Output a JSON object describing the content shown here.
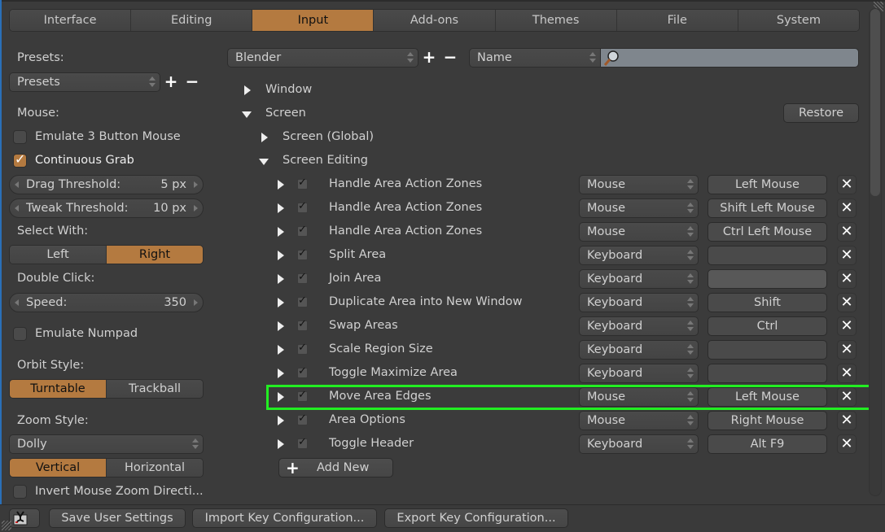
{
  "tabs": [
    {
      "label": "Interface",
      "active": false
    },
    {
      "label": "Editing",
      "active": false
    },
    {
      "label": "Input",
      "active": true
    },
    {
      "label": "Add-ons",
      "active": false
    },
    {
      "label": "Themes",
      "active": false
    },
    {
      "label": "File",
      "active": false
    },
    {
      "label": "System",
      "active": false
    }
  ],
  "left": {
    "presets_label": "Presets:",
    "presets_value": "Presets",
    "mouse_label": "Mouse:",
    "emulate_3button": {
      "label": "Emulate 3 Button Mouse",
      "checked": false
    },
    "continuous_grab": {
      "label": "Continuous Grab",
      "checked": true
    },
    "drag_threshold": {
      "label": "Drag Threshold:",
      "value": "5 px"
    },
    "tweak_threshold": {
      "label": "Tweak Threshold:",
      "value": "10 px"
    },
    "select_with_label": "Select With:",
    "select_with": {
      "options": [
        "Left",
        "Right"
      ],
      "selected": "Right"
    },
    "double_click_label": "Double Click:",
    "speed": {
      "label": "Speed:",
      "value": "350"
    },
    "emulate_numpad": {
      "label": "Emulate Numpad",
      "checked": false
    },
    "orbit_style_label": "Orbit Style:",
    "orbit_style": {
      "options": [
        "Turntable",
        "Trackball"
      ],
      "selected": "Turntable"
    },
    "zoom_style_label": "Zoom Style:",
    "zoom_style_value": "Dolly",
    "zoom_axis": {
      "options": [
        "Vertical",
        "Horizontal"
      ],
      "selected": "Vertical"
    },
    "invert_zoom": {
      "label": "Invert Mouse Zoom Directi...",
      "checked": false
    }
  },
  "keymap": {
    "preset_value": "Blender",
    "filter_type": "Name",
    "search_value": "",
    "restore_label": "Restore",
    "tree": {
      "window": "Window",
      "screen": "Screen",
      "screen_global": "Screen (Global)",
      "screen_editing": "Screen Editing"
    },
    "items": [
      {
        "name": "Handle Area Action Zones",
        "type": "Mouse",
        "key": "Left Mouse"
      },
      {
        "name": "Handle Area Action Zones",
        "type": "Mouse",
        "key": "Shift Left Mouse"
      },
      {
        "name": "Handle Area Action Zones",
        "type": "Mouse",
        "key": "Ctrl Left Mouse"
      },
      {
        "name": "Split Area",
        "type": "Keyboard",
        "key": ""
      },
      {
        "name": "Join Area",
        "type": "Keyboard",
        "key": ""
      },
      {
        "name": "Duplicate Area into New Window",
        "type": "Keyboard",
        "key": "Shift"
      },
      {
        "name": "Swap Areas",
        "type": "Keyboard",
        "key": "Ctrl"
      },
      {
        "name": "Scale Region Size",
        "type": "Keyboard",
        "key": ""
      },
      {
        "name": "Toggle Maximize Area",
        "type": "Keyboard",
        "key": ""
      },
      {
        "name": "Move Area Edges",
        "type": "Mouse",
        "key": "Left Mouse"
      },
      {
        "name": "Area Options",
        "type": "Mouse",
        "key": "Right Mouse"
      },
      {
        "name": "Toggle Header",
        "type": "Keyboard",
        "key": "Alt F9"
      }
    ],
    "add_new_label": "Add New"
  },
  "bottom": {
    "save_label": "Save User Settings",
    "import_label": "Import Key Configuration...",
    "export_label": "Export Key Configuration..."
  },
  "colors": {
    "accent": "#b47a40",
    "highlight": "#22ee22"
  }
}
